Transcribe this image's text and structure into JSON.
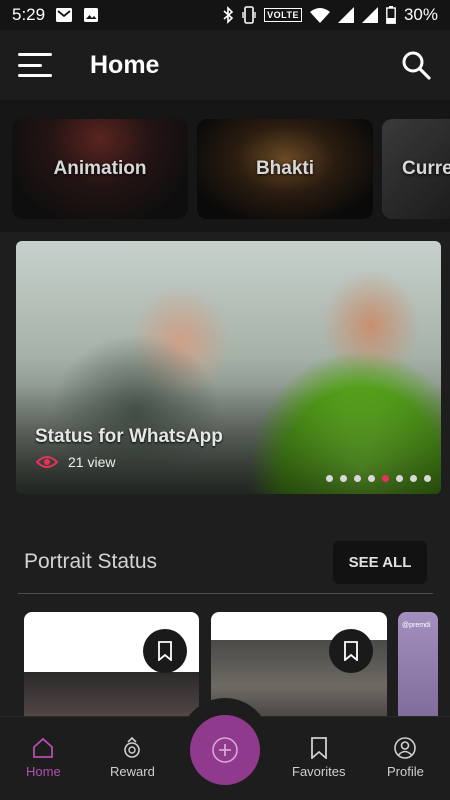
{
  "status_bar": {
    "time": "5:29",
    "network_label": "VOLTE",
    "battery": "30%",
    "icons": [
      "message-icon",
      "image-icon",
      "bluetooth-icon",
      "vibrate-icon",
      "wifi-icon",
      "signal-icon",
      "battery-icon"
    ]
  },
  "app_bar": {
    "title": "Home",
    "icons": [
      "menu-icon",
      "search-icon"
    ]
  },
  "categories": [
    {
      "label": "Animation"
    },
    {
      "label": "Bhakti"
    },
    {
      "label": "Curre"
    }
  ],
  "banner": {
    "title": "Status for WhatsApp",
    "views": "21 view",
    "dot_count": 8,
    "active_dot": 4
  },
  "portrait_section": {
    "title": "Portrait Status",
    "see_all": "SEE ALL",
    "partial_card_text": "@premdi"
  },
  "bottom_nav": {
    "items": [
      {
        "label": "Home",
        "icon": "home-icon",
        "active": true
      },
      {
        "label": "Reward",
        "icon": "reward-icon",
        "active": false
      },
      {
        "label": "Favorites",
        "icon": "bookmark-icon",
        "active": false
      },
      {
        "label": "Profile",
        "icon": "profile-icon",
        "active": false
      }
    ],
    "fab_icon": "add-icon"
  },
  "colors": {
    "accent": "#8f3a8c",
    "active_nav": "#b24fb0",
    "active_dot": "#e8315a",
    "view_icon": "#e8315a"
  }
}
